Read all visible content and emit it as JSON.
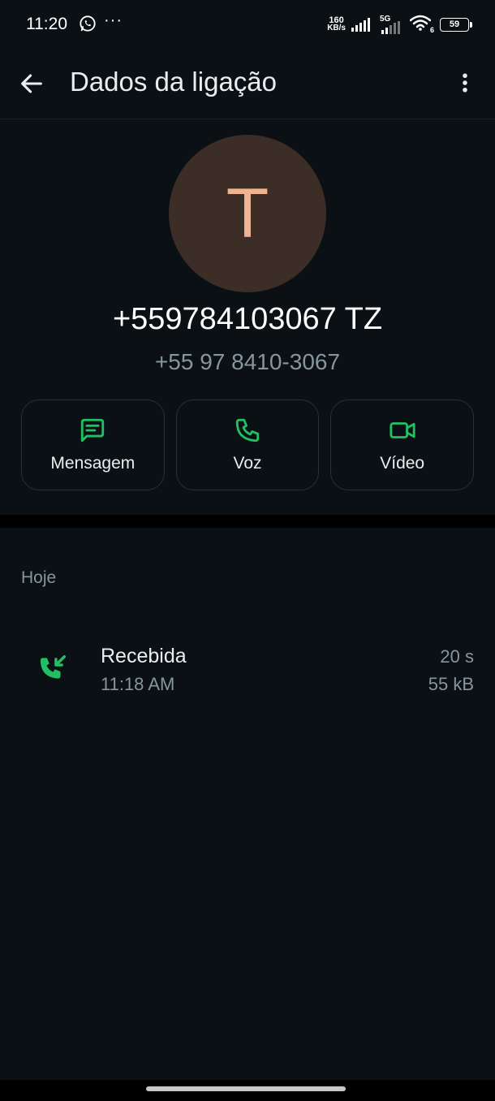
{
  "status_bar": {
    "time": "11:20",
    "dots": "···",
    "speed_value": "160",
    "speed_unit": "KB/s",
    "network": "5G",
    "wifi_label": "6",
    "battery": "59"
  },
  "header": {
    "title": "Dados da ligação"
  },
  "contact": {
    "initial": "T",
    "name": "+559784103067 TZ",
    "number": "+55 97 8410-3067"
  },
  "actions": [
    {
      "label": "Mensagem",
      "icon": "message-icon"
    },
    {
      "label": "Voz",
      "icon": "phone-icon"
    },
    {
      "label": "Vídeo",
      "icon": "video-icon"
    }
  ],
  "history": {
    "section_label": "Hoje",
    "calls": [
      {
        "type": "Recebida",
        "time": "11:18 AM",
        "duration": "20 s",
        "size": "55 kB",
        "icon": "incoming-call-icon"
      }
    ]
  },
  "colors": {
    "background": "#0b1014",
    "accent_green": "#21c063",
    "avatar_bg": "#3c2d27",
    "avatar_letter": "#eeb393",
    "secondary_text": "#8696a0"
  }
}
